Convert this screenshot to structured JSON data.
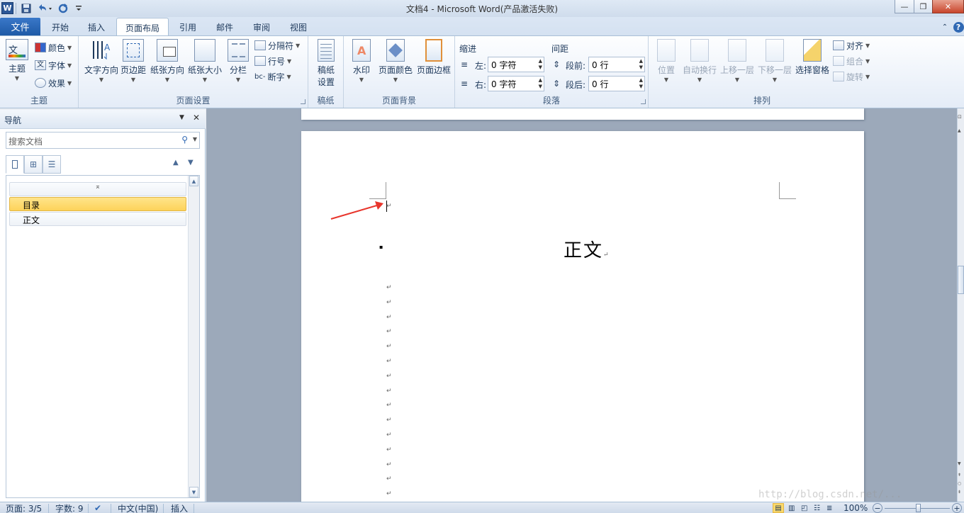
{
  "titlebar": {
    "title": "文档4 - Microsoft Word(产品激活失败)",
    "logo": "W",
    "win_min": "—",
    "win_max": "❐",
    "win_close": "✕"
  },
  "tabs": {
    "file": "文件",
    "items": [
      "开始",
      "插入",
      "页面布局",
      "引用",
      "邮件",
      "审阅",
      "视图"
    ],
    "active_index": 2,
    "help_icon": "?"
  },
  "ribbon": {
    "theme_group": {
      "label": "主题",
      "theme": "主题",
      "colors": "颜色",
      "fonts": "字体",
      "effects": "效果"
    },
    "page_setup_group": {
      "label": "页面设置",
      "text_direction": "文字方向",
      "margins": "页边距",
      "orientation": "纸张方向",
      "size": "纸张大小",
      "columns": "分栏",
      "breaks": "分隔符",
      "line_numbers": "行号",
      "hyphenation": "断字"
    },
    "manuscript_group": {
      "label": "稿纸",
      "settings_line1": "稿纸",
      "settings_line2": "设置"
    },
    "page_background_group": {
      "label": "页面背景",
      "watermark": "水印",
      "page_color": "页面颜色",
      "page_borders": "页面边框"
    },
    "paragraph_group": {
      "label": "段落",
      "indent": "缩进",
      "spacing": "间距",
      "left_label": "左:",
      "left_value": "0 字符",
      "right_label": "右:",
      "right_value": "0 字符",
      "before_label": "段前:",
      "before_value": "0 行",
      "after_label": "段后:",
      "after_value": "0 行"
    },
    "arrange_group": {
      "label": "排列",
      "position": "位置",
      "wrap_text": "自动换行",
      "bring_forward": "上移一层",
      "send_backward": "下移一层",
      "selection_pane": "选择窗格",
      "align": "对齐",
      "group": "组合",
      "rotate": "旋转"
    }
  },
  "nav_pane": {
    "title": "导航",
    "search_placeholder": "搜索文档",
    "headings": [
      {
        "text": "目录",
        "selected": true
      },
      {
        "text": "正文",
        "selected": false
      }
    ],
    "collapse_glyph": "⌅"
  },
  "document": {
    "heading": "正文",
    "para_mark": "↵",
    "bullet": "▪",
    "empty_paragraph_count": 15
  },
  "statusbar": {
    "page": "页面: 3/5",
    "words": "字数: 9",
    "language": "中文(中国)",
    "mode": "插入",
    "zoom": "100%"
  },
  "watermark_text": "http://blog.csdn.net/...",
  "colors": {
    "file_tab": "#1e5aa6",
    "selected_heading": "#fdd35a",
    "arrow_annotation": "#e8352c"
  }
}
